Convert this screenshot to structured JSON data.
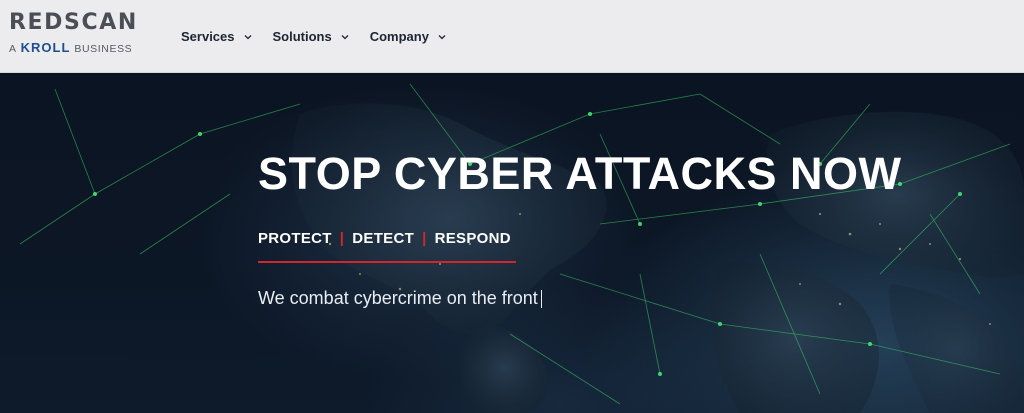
{
  "header": {
    "logo": {
      "main": "REDSCAN",
      "sub_prefix": "A",
      "sub_brand": "KROLL",
      "sub_suffix": "BUSINESS"
    },
    "nav": [
      {
        "label": "Services",
        "icon": "chevron-down-icon"
      },
      {
        "label": "Solutions",
        "icon": "chevron-down-icon"
      },
      {
        "label": "Company",
        "icon": "chevron-down-icon"
      }
    ]
  },
  "hero": {
    "title": "STOP CYBER ATTACKS NOW",
    "tags": [
      "PROTECT",
      "DETECT",
      "RESPOND"
    ],
    "separator": "|",
    "subtitle": "We combat cybercrime on the front",
    "background": "world-map-network-image"
  },
  "colors": {
    "header_bg": "#ececee",
    "nav_text": "#1d2433",
    "accent_red": "#d1262e",
    "hero_bg": "#0a1320",
    "network_green": "#3ddc6a"
  }
}
